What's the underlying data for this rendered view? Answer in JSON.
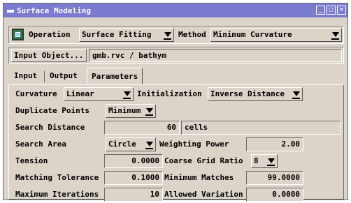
{
  "window": {
    "title": "Surface Modeling",
    "controls": [
      "_",
      "□",
      "×"
    ]
  },
  "toolbar": {
    "icon": "surface-app-icon",
    "operation_label": "Operation",
    "operation_value": "Surface Fitting",
    "method_label": "Method",
    "method_value": "Minimum Curvature"
  },
  "input_object": {
    "button_label": "Input Object...",
    "value": "gmb.rvc / bathym"
  },
  "tabs": [
    {
      "label": "Input",
      "active": false
    },
    {
      "label": "Output",
      "active": false
    },
    {
      "label": "Parameters",
      "active": true
    }
  ],
  "params": {
    "curvature_label": "Curvature",
    "curvature_value": "Linear",
    "initialization_label": "Initialization",
    "initialization_value": "Inverse Distance",
    "duplicate_points_label": "Duplicate Points",
    "duplicate_points_value": "Minimum",
    "search_distance_label": "Search Distance",
    "search_distance_value": "60",
    "search_distance_unit": "cells",
    "search_area_label": "Search Area",
    "search_area_value": "Circle",
    "weighting_power_label": "Weighting Power",
    "weighting_power_value": "2.00",
    "tension_label": "Tension",
    "tension_value": "0.0000",
    "coarse_grid_ratio_label": "Coarse Grid Ratio",
    "coarse_grid_ratio_value": "8",
    "matching_tolerance_label": "Matching Tolerance",
    "matching_tolerance_value": "0.1000",
    "minimum_matches_label": "Minimum Matches",
    "minimum_matches_value": "99.0000",
    "maximum_iterations_label": "Maximum Iterations",
    "maximum_iterations_value": "10",
    "allowed_variation_label": "Allowed Variation",
    "allowed_variation_value": "0.0000"
  }
}
